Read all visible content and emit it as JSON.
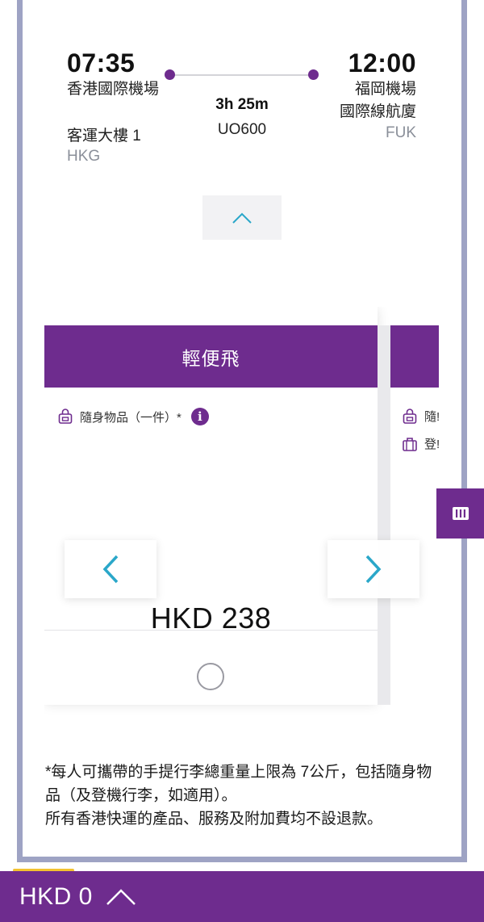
{
  "flight": {
    "departure_time": "07:35",
    "departure_airport": "香港國際機場",
    "departure_terminal": "客運大樓 1",
    "departure_code": "HKG",
    "arrival_time": "12:00",
    "arrival_airport_line1": "福岡機場",
    "arrival_airport_line2": "國際線航廈",
    "arrival_code": "FUK",
    "duration": "3h 25m",
    "flight_number": "UO600"
  },
  "fare_card": {
    "name": "輕便飛",
    "feature_carry_on": "隨身物品（一件）*",
    "price": "HKD 238"
  },
  "fare_card_next": {
    "feature_1_partial": "隨!",
    "feature_2_partial": "登!"
  },
  "footnote": {
    "line1": "*每人可攜帶的手提行李總重量上限為 7公斤，包括隨身物品（及登機行李，如適用）。",
    "line2": "所有香港快運的產品、服務及附加費均不設退款。"
  },
  "bottom_bar": {
    "total": "HKD 0"
  },
  "colors": {
    "brand_purple": "#6e2c8e",
    "nav_arrow": "#2aa7c9",
    "accent_yellow": "#f2c230"
  },
  "icons": {
    "collapse": "chevron-up-icon",
    "prev": "chevron-left-icon",
    "next": "chevron-right-icon",
    "carry_on": "bag-icon",
    "checked_baggage": "luggage-icon",
    "info": "info-icon",
    "side_tab": "menu-icon",
    "bottom_expand": "chevron-up-icon"
  }
}
